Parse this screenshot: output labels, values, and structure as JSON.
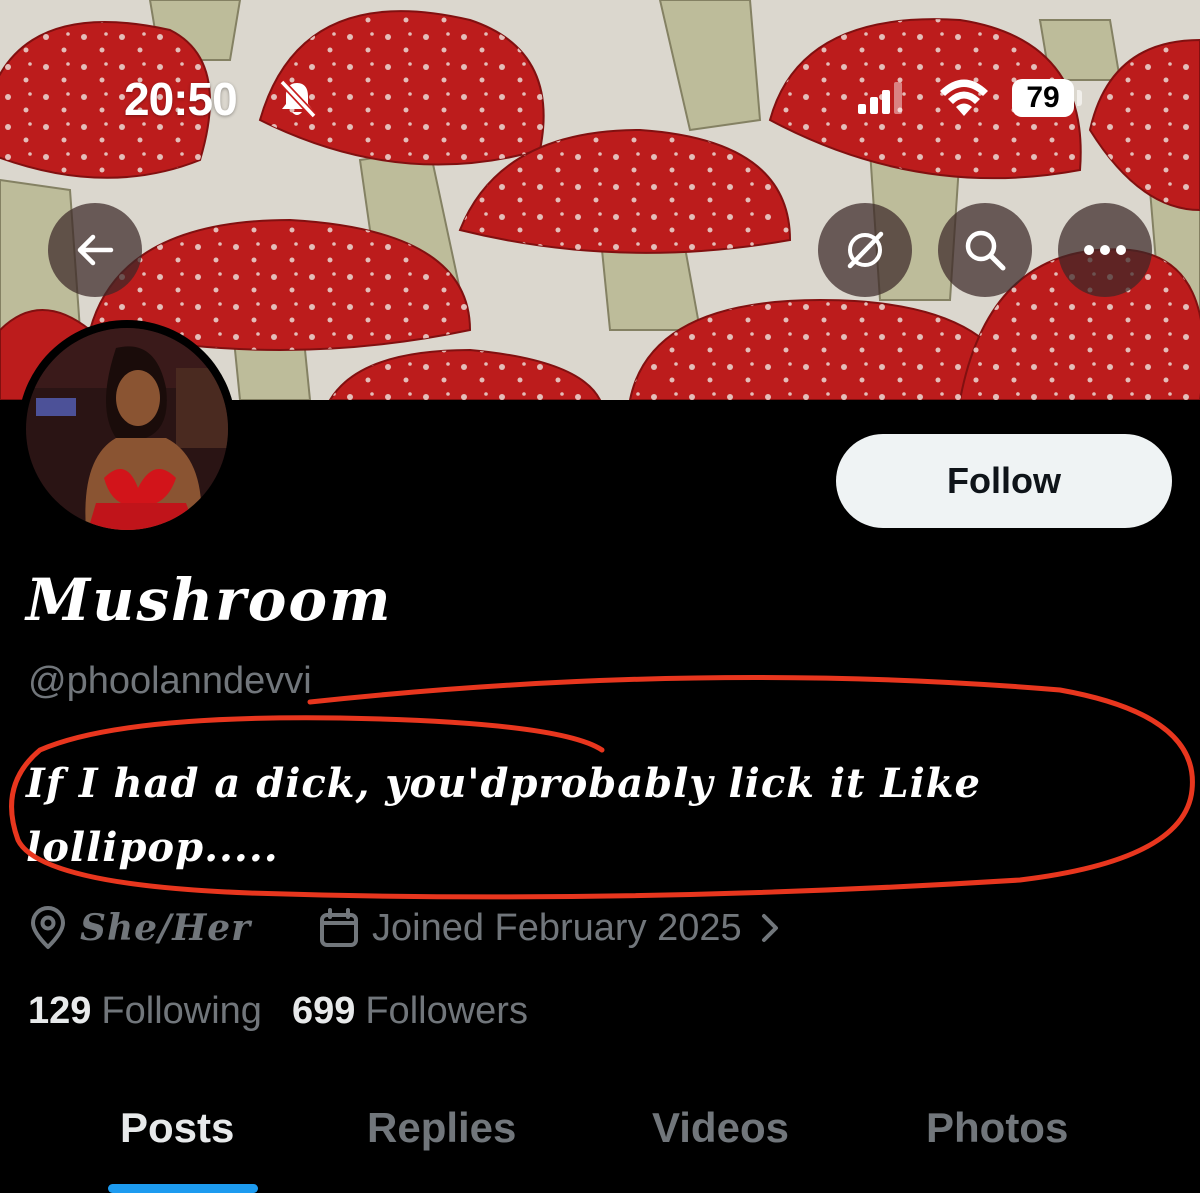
{
  "status_bar": {
    "time": "20:50",
    "battery": "79",
    "icons": [
      "bell-slash-icon",
      "signal-icon",
      "wifi-icon",
      "battery-icon"
    ]
  },
  "nav": {
    "icons": [
      "arrow-left-icon",
      "grok-icon",
      "search-icon",
      "more-icon"
    ]
  },
  "profile": {
    "follow_label": "Follow",
    "display_name": "Mushroom",
    "handle": "@phoolanndevvi",
    "bio": "If I had a dick, you'dprobably lick it Like lollipop.....",
    "location": "She/Her",
    "joined": "Joined February 2025",
    "following_count": "129",
    "following_label": "Following",
    "followers_count": "699",
    "followers_label": "Followers"
  },
  "tabs": [
    "Posts",
    "Replies",
    "Videos",
    "Photos"
  ],
  "colors": {
    "background": "#000000",
    "accent": "#1d9bf0",
    "muted_text": "#71767b",
    "annotation": "#e8361e",
    "mushroom_red": "#c81e1e"
  }
}
